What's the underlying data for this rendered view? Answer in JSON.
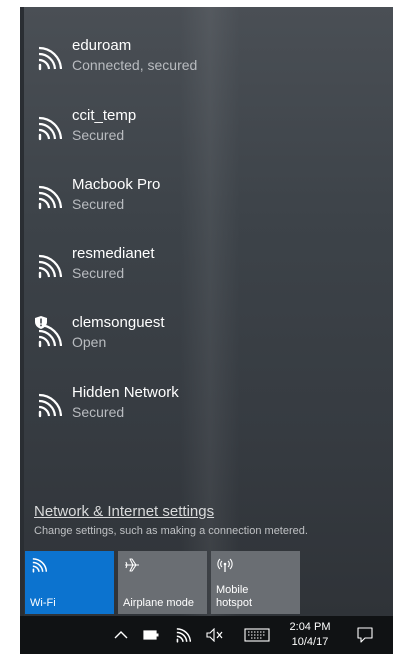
{
  "networks": [
    {
      "name": "eduroam",
      "status": "Connected, secured",
      "secured": true
    },
    {
      "name": "ccit_temp",
      "status": "Secured",
      "secured": true
    },
    {
      "name": "Macbook Pro",
      "status": "Secured",
      "secured": true
    },
    {
      "name": "resmedianet",
      "status": "Secured",
      "secured": true
    },
    {
      "name": "clemsonguest",
      "status": "Open",
      "secured": false
    },
    {
      "name": "Hidden Network",
      "status": "Secured",
      "secured": true
    }
  ],
  "settings": {
    "link_label": "Network & Internet settings",
    "description": "Change settings, such as making a connection metered."
  },
  "quick_actions": [
    {
      "label": "Wi-Fi",
      "icon": "wifi-icon",
      "active": true
    },
    {
      "label": "Airplane mode",
      "icon": "airplane-icon",
      "active": false
    },
    {
      "label_line1": "Mobile",
      "label_line2": "hotspot",
      "icon": "hotspot-icon",
      "active": false
    }
  ],
  "taskbar": {
    "time": "2:04 PM",
    "date": "10/4/17",
    "icons": [
      "chevron-up-icon",
      "battery-icon",
      "wifi-icon",
      "volume-muted-icon",
      "keyboard-icon",
      "action-center-icon"
    ]
  },
  "colors": {
    "accent": "#0078d7",
    "panel": "#3d4349",
    "tile_inactive": "#6a6e73",
    "taskbar": "#101214"
  }
}
